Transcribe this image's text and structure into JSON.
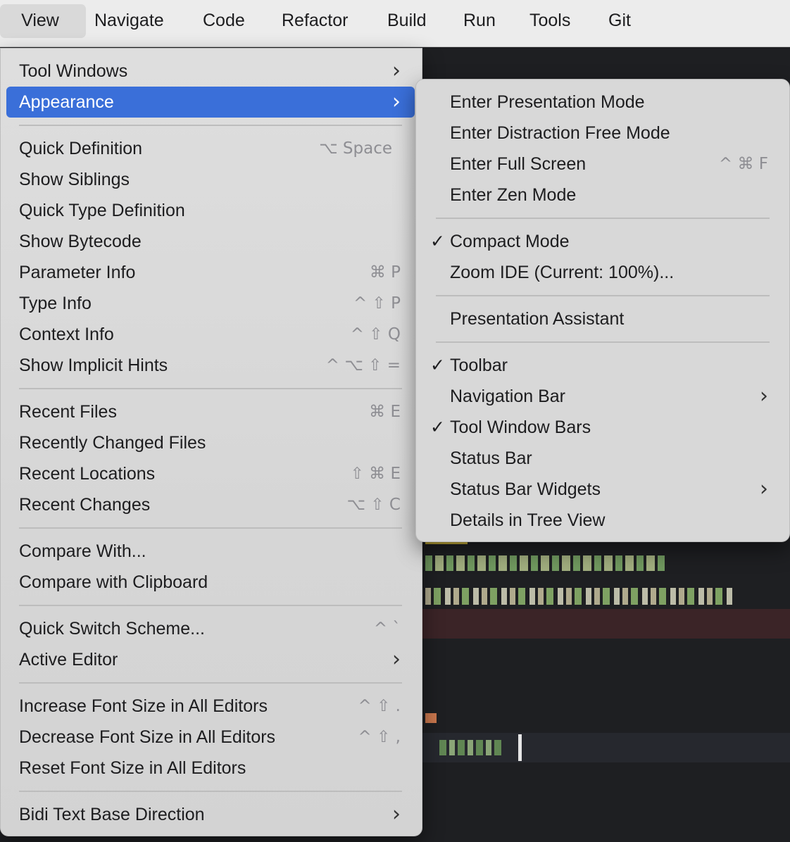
{
  "menubar": {
    "items": [
      "View",
      "Navigate",
      "Code",
      "Refactor",
      "Build",
      "Run",
      "Tools",
      "Git"
    ]
  },
  "view_menu": {
    "tool_windows": "Tool Windows",
    "appearance": "Appearance",
    "quick_definition": {
      "label": "Quick Definition",
      "shortcut": "⌥ Space"
    },
    "show_siblings": "Show Siblings",
    "quick_type_definition": "Quick Type Definition",
    "show_bytecode": "Show Bytecode",
    "parameter_info": {
      "label": "Parameter Info",
      "shortcut": "⌘ P"
    },
    "type_info": {
      "label": "Type Info",
      "shortcut": "^ ⇧ P"
    },
    "context_info": {
      "label": "Context Info",
      "shortcut": "^ ⇧ Q"
    },
    "show_implicit_hints": {
      "label": "Show Implicit Hints",
      "shortcut": "^ ⌥ ⇧ ="
    },
    "recent_files": {
      "label": "Recent Files",
      "shortcut": "⌘ E"
    },
    "recently_changed_files": "Recently Changed Files",
    "recent_locations": {
      "label": "Recent Locations",
      "shortcut": "⇧ ⌘ E"
    },
    "recent_changes": {
      "label": "Recent Changes",
      "shortcut": "⌥ ⇧ C"
    },
    "compare_with": "Compare With...",
    "compare_with_clipboard": "Compare with Clipboard",
    "quick_switch_scheme": {
      "label": "Quick Switch Scheme...",
      "shortcut": "^ `"
    },
    "active_editor": "Active Editor",
    "increase_font": {
      "label": "Increase Font Size in All Editors",
      "shortcut": "^ ⇧ ."
    },
    "decrease_font": {
      "label": "Decrease Font Size in All Editors",
      "shortcut": "^ ⇧ ,"
    },
    "reset_font": "Reset Font Size in All Editors",
    "bidi": "Bidi Text Base Direction"
  },
  "appearance_menu": {
    "presentation_mode": "Enter Presentation Mode",
    "distraction_free_mode": "Enter Distraction Free Mode",
    "full_screen": {
      "label": "Enter Full Screen",
      "shortcut": "^ ⌘ F"
    },
    "zen_mode": "Enter Zen Mode",
    "compact_mode": {
      "label": "Compact Mode",
      "checked": true
    },
    "zoom_ide": "Zoom IDE (Current: 100%)...",
    "presentation_assistant": "Presentation Assistant",
    "toolbar": {
      "label": "Toolbar",
      "checked": true
    },
    "navigation_bar": "Navigation Bar",
    "tool_window_bars": {
      "label": "Tool Window Bars",
      "checked": true
    },
    "status_bar": "Status Bar",
    "status_bar_widgets": "Status Bar Widgets",
    "details_in_tree_view": "Details in Tree View"
  },
  "glyphs": {
    "chevron": "›",
    "check": "✓"
  },
  "colors": {
    "selection": "#3a6fd9",
    "editor_bg": "#1e1f22",
    "error_line": "#3b2427"
  }
}
